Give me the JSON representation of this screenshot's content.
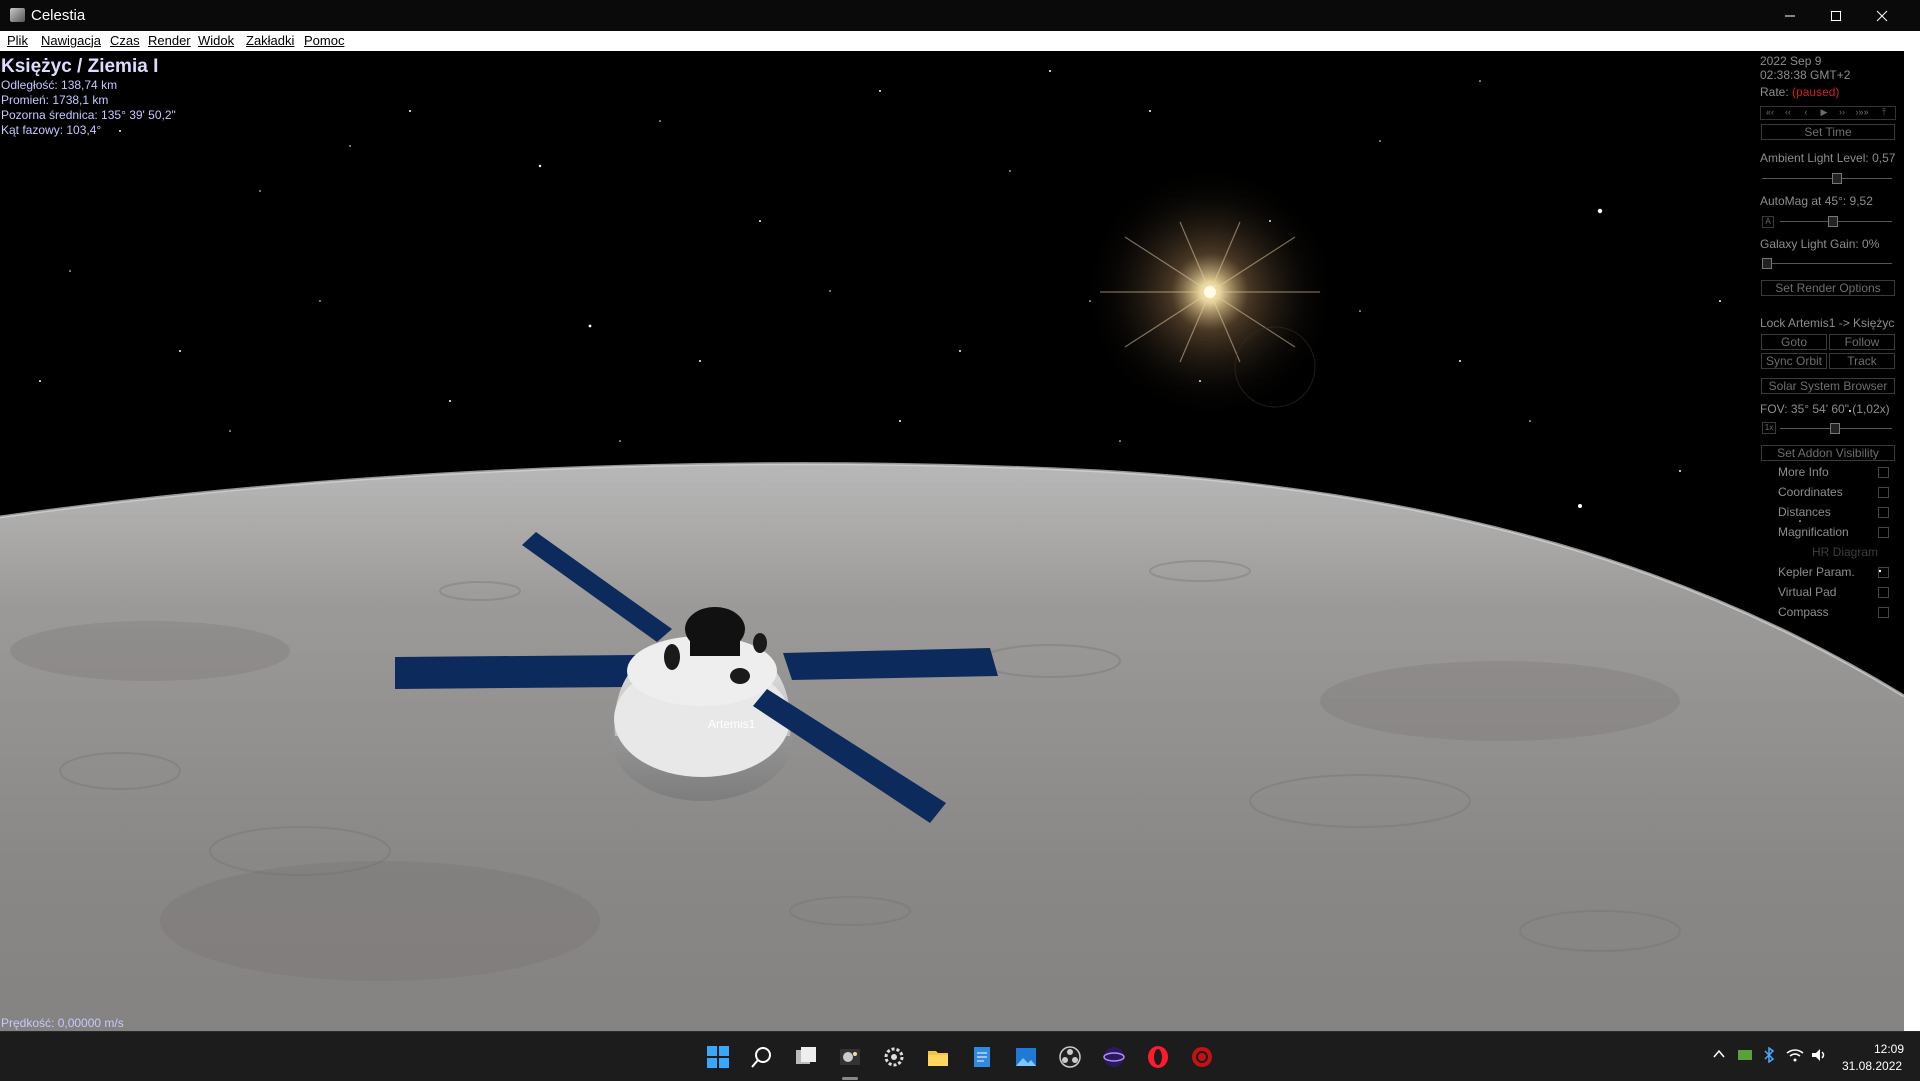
{
  "window": {
    "title": "Celestia"
  },
  "menu": [
    "Plik",
    "Nawigacja",
    "Czas",
    "Render",
    "Widok",
    "Zakładki",
    "Pomoc"
  ],
  "hud": {
    "object_title": "Księżyc / Ziemia I",
    "distance": "Odległość: 138,74 km",
    "radius": "Promień: 1738,1 km",
    "apparent_diameter": "Pozorna średnica: 135° 39' 50,2\"",
    "phase_angle": "Kąt fazowy: 103,4°",
    "speed": "Prędkość: 0,00000 m/s"
  },
  "spacecraft_label": "Artemis1",
  "panel": {
    "date": "2022 Sep 9",
    "time": "02:38:38 GMT+2",
    "rate_label": "Rate:",
    "rate_value": "(paused)",
    "time_controls": [
      "«‹",
      "‹‹",
      "‹",
      "▶",
      "››",
      "›»»",
      "⤒"
    ],
    "set_time": "Set Time",
    "ambient_light": "Ambient Light Level: 0,57",
    "ambient_value": 0.57,
    "automag": "AutoMag at 45°: 9,52",
    "automag_button": "A",
    "galaxy_gain": "Galaxy Light Gain: 0%",
    "set_render_options": "Set Render Options",
    "lock_label": "Lock Artemis1 -> Księżyc",
    "goto": "Goto",
    "follow": "Follow",
    "sync_orbit": "Sync Orbit",
    "track": "Track",
    "solar_system_browser": "Solar System Browser",
    "fov": "FOV: 35° 54' 60\" (1,02x)",
    "fov_button": "1x",
    "set_addon_visibility": "Set Addon Visibility",
    "checkboxes": [
      {
        "label": "More Info",
        "enabled": true
      },
      {
        "label": "Coordinates",
        "enabled": true
      },
      {
        "label": "Distances",
        "enabled": true
      },
      {
        "label": "Magnification",
        "enabled": true
      },
      {
        "label": "HR Diagram",
        "enabled": false
      },
      {
        "label": "Kepler Param.",
        "enabled": true
      },
      {
        "label": "Virtual Pad",
        "enabled": true
      },
      {
        "label": "Compass",
        "enabled": true
      }
    ]
  },
  "taskbar": {
    "time": "12:09",
    "date": "31.08.2022",
    "icons": [
      "windows-start-icon",
      "search-icon",
      "task-view-icon",
      "celestia-icon",
      "settings-icon",
      "file-explorer-icon",
      "notepad-icon",
      "photos-icon",
      "obs-icon",
      "app-icon",
      "opera-icon",
      "app-red-icon"
    ]
  },
  "colors": {
    "hud_text": "#c6c8ff",
    "panel_text": "#8d8d8d",
    "paused_red": "#cc2222",
    "solar_panel": "#0c2a5c"
  }
}
